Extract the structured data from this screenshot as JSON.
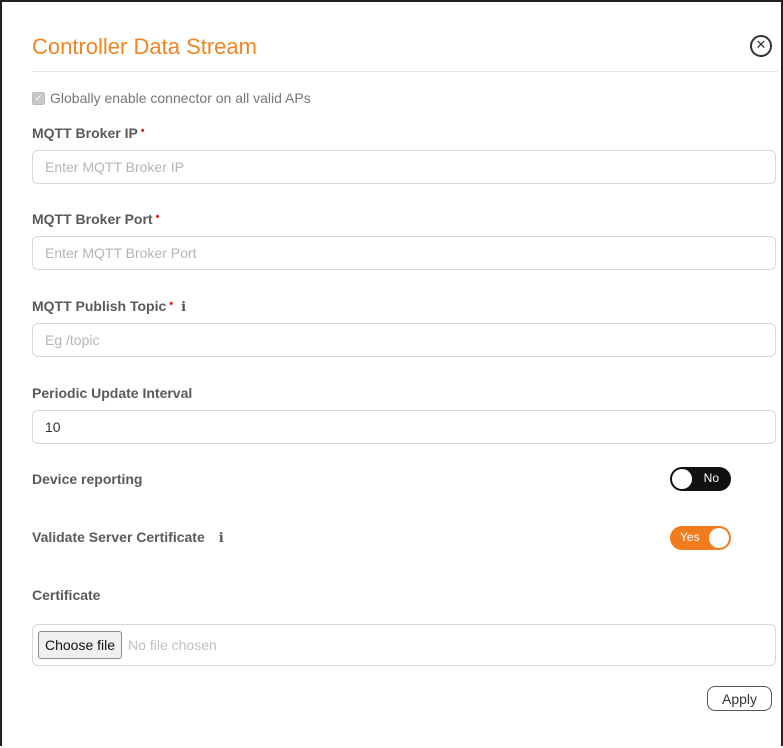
{
  "dialog": {
    "title": "Controller Data Stream",
    "close_icon": "circle-x-icon"
  },
  "global_enable": {
    "label": "Globally enable connector on all valid APs",
    "checked": true
  },
  "fields": {
    "broker_ip": {
      "label": "MQTT Broker IP",
      "required_mark": "•",
      "placeholder": "Enter MQTT Broker IP",
      "value": ""
    },
    "broker_port": {
      "label": "MQTT Broker Port",
      "required_mark": "•",
      "placeholder": "Enter MQTT Broker Port",
      "value": ""
    },
    "publish_topic": {
      "label": "MQTT Publish Topic",
      "required_mark": "•",
      "info_icon": "info-icon",
      "info_glyph": "i",
      "placeholder": "Eg /topic",
      "value": ""
    },
    "update_interval": {
      "label": "Periodic Update Interval",
      "value": "10"
    }
  },
  "device_reporting": {
    "label": "Device reporting",
    "state_text": "No",
    "on": false
  },
  "validate_cert": {
    "label": "Validate Server Certificate",
    "info_icon": "info-icon",
    "info_glyph": "i",
    "state_text": "Yes",
    "on": true
  },
  "certificate": {
    "label": "Certificate",
    "button_label": "Choose file",
    "status": "No file chosen"
  },
  "actions": {
    "apply_label": "Apply"
  },
  "colors": {
    "accent": "#f08522",
    "toggle_on": "#f07c1c",
    "toggle_off": "#111111",
    "required": "#e02020"
  }
}
